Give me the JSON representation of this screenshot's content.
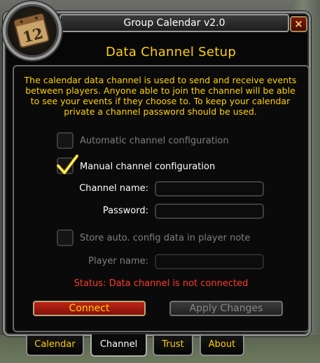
{
  "window": {
    "title": "Group Calendar v2.0",
    "close_label": "×",
    "calendar_icon_number": "12"
  },
  "channel_setup": {
    "heading": "Data Channel Setup",
    "description": "The calendar data channel is used to send and receive events between players.  Anyone able to join the channel will be able to see your events if they choose to.  To keep your calendar private a channel password should be used.",
    "auto_config": {
      "label": "Automatic channel configuration",
      "checked": false,
      "enabled": false
    },
    "manual_config": {
      "label": "Manual channel configuration",
      "checked": true,
      "enabled": true
    },
    "channel_name": {
      "label": "Channel name:",
      "value": ""
    },
    "password": {
      "label": "Password:",
      "value": ""
    },
    "store_config": {
      "label": "Store auto. config data in player note",
      "checked": false,
      "enabled": false
    },
    "player_name": {
      "label": "Player name:",
      "value": ""
    },
    "status": "Status: Data channel is not connected",
    "connect_label": "Connect",
    "apply_label": "Apply Changes"
  },
  "tabs": [
    {
      "label": "Calendar",
      "active": false
    },
    {
      "label": "Channel",
      "active": true
    },
    {
      "label": "Trust",
      "active": false
    },
    {
      "label": "About",
      "active": false
    }
  ],
  "colors": {
    "gold_text": "#ffd100",
    "status_red": "#ff3a2a",
    "disabled_text": "#7f7f7f",
    "connect_red": "#c02514"
  },
  "icons": {
    "close": "close-icon",
    "checkmark": "checkmark-icon",
    "calendar": "calendar-icon"
  }
}
